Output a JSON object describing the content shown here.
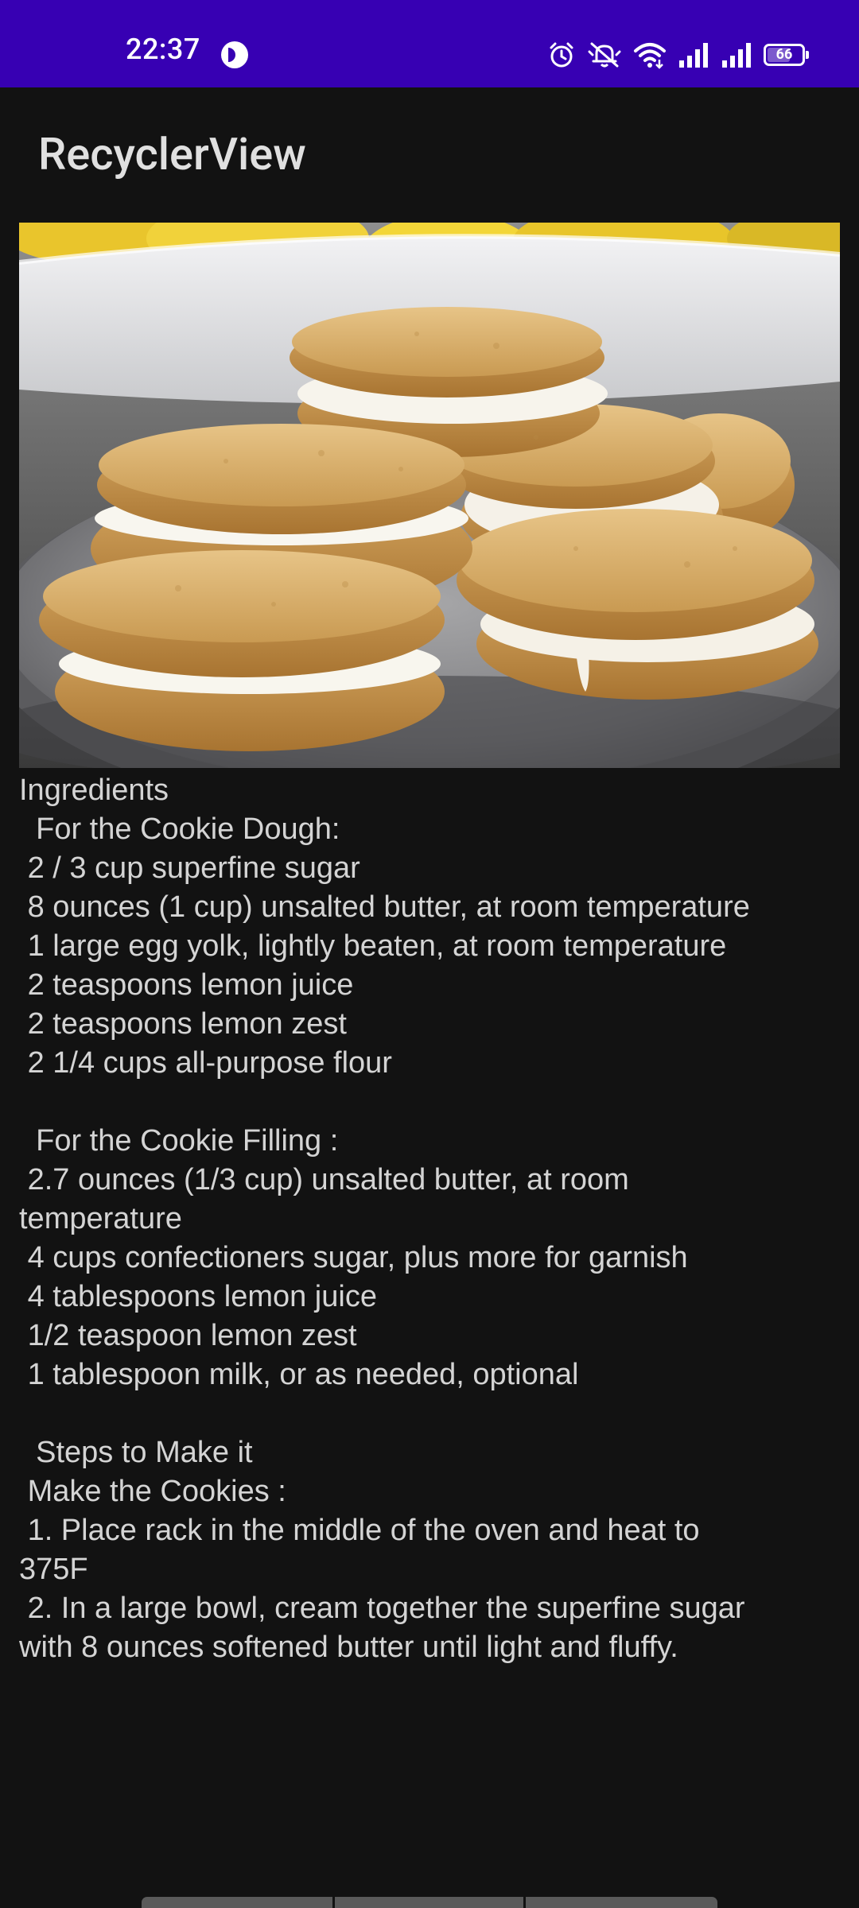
{
  "status_bar": {
    "time": "22:37",
    "battery_level": "66",
    "icons": [
      "app-notification-icon",
      "alarm-icon",
      "mute-icon",
      "wifi-icon",
      "cell-signal-icon",
      "cell-signal-icon",
      "battery-icon"
    ],
    "background_color": "#3700b3"
  },
  "app_bar": {
    "title": "RecyclerView"
  },
  "recipe": {
    "image_alt": "Lemon sandwich cookies on a plate",
    "text": "Ingredients\n  For the Cookie Dough:\n 2 / 3 cup superfine sugar\n 8 ounces (1 cup) unsalted butter, at room temperature\n 1 large egg yolk, lightly beaten, at room temperature\n 2 teaspoons lemon juice\n 2 teaspoons lemon zest\n 2 1/4 cups all-purpose flour\n\n  For the Cookie Filling :\n 2.7 ounces (1/3 cup) unsalted butter, at room\ntemperature\n 4 cups confectioners sugar, plus more for garnish\n 4 tablespoons lemon juice\n 1/2 teaspoon lemon zest\n 1 tablespoon milk, or as needed, optional\n\n  Steps to Make it\n Make the Cookies :\n 1. Place rack in the middle of the oven and heat to\n375F\n 2. In a large bowl, cream together the superfine sugar\nwith 8 ounces softened butter until light and fluffy."
  }
}
